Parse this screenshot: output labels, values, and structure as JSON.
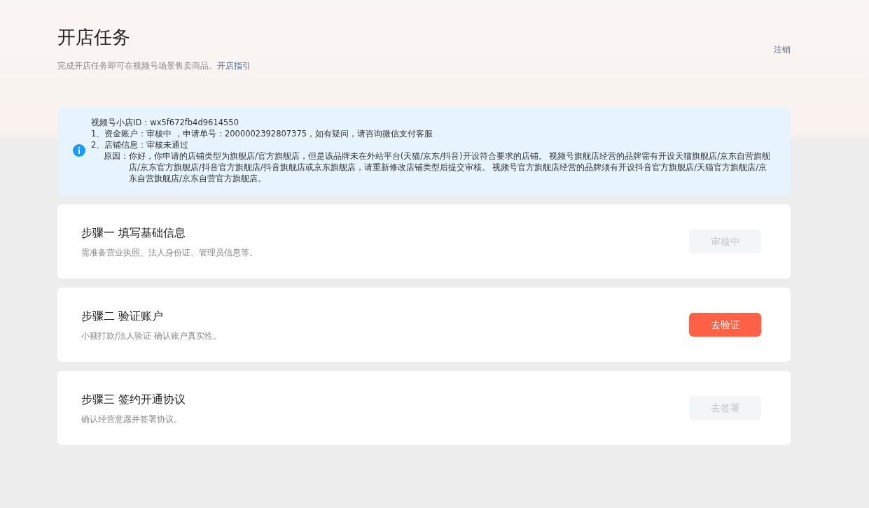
{
  "header": {
    "title": "开店任务",
    "subtitle": "完成开店任务即可在视频号场景售卖商品。",
    "guide_link": "开店指引",
    "logout": "注销"
  },
  "notice": {
    "lines": [
      "视频号小店ID：wx5f672fb4d9614550",
      "1、资金账户：审核中 ，申请单号：2000002392807375，如有疑问，请咨询微信支付客服",
      "2、店铺信息：审核未通过"
    ],
    "reason_label": "原因：",
    "reason": "你好，你申请的店铺类型为旗舰店/官方旗舰店，但是该品牌未在外站平台(天猫/京东/抖音)开设符合要求的店铺。 视频号旗舰店经营的品牌需有开设天猫旗舰店/京东自营旗舰店/京东官方旗舰店/抖音官方旗舰店/抖音旗舰店或京东旗舰店，请重新修改店铺类型后提交审核。 视频号官方旗舰店经营的品牌须有开设抖音官方旗舰店/天猫官方旗舰店/京东自营旗舰店/京东自营官方旗舰店。"
  },
  "steps": [
    {
      "title": "步骤一 填写基础信息",
      "description": "需准备营业执照、法人身份证、管理员信息等。",
      "button": "审核中",
      "disabled": true
    },
    {
      "title": "步骤二 验证账户",
      "description": "小额打款/法人验证 确认账户真实性。",
      "button": "去验证",
      "disabled": false
    },
    {
      "title": "步骤三 签约开通协议",
      "description": "确认经营意愿并签署协议。",
      "button": "去签署",
      "disabled": true
    }
  ]
}
